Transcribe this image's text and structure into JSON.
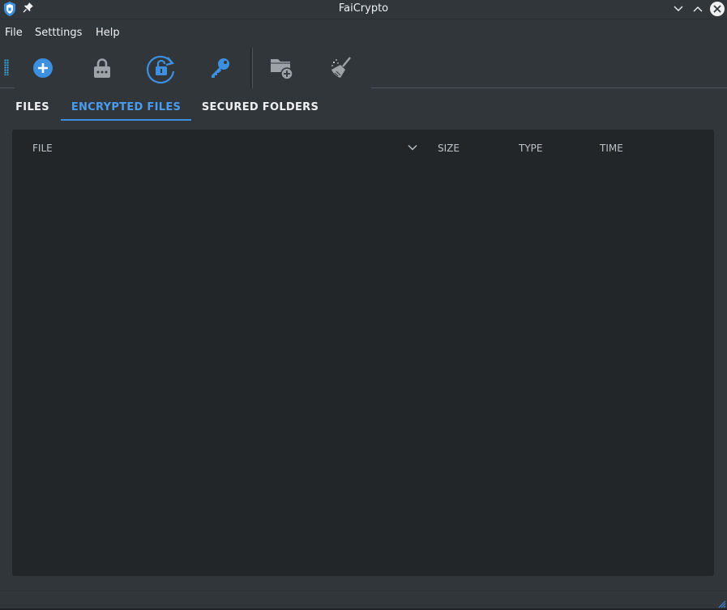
{
  "window": {
    "title": "FaiCrypto"
  },
  "menu": {
    "file": "File",
    "settings": "Setttings",
    "help": "Help"
  },
  "toolbar": {
    "buttons": [
      {
        "name": "add",
        "icon": "plus-circle-icon"
      },
      {
        "name": "encrypt",
        "icon": "lock-icon"
      },
      {
        "name": "decrypt",
        "icon": "unlock-refresh-icon"
      },
      {
        "name": "key",
        "icon": "key-icon"
      },
      {
        "name": "add-folder",
        "icon": "folder-plus-icon"
      },
      {
        "name": "clean",
        "icon": "broom-icon"
      }
    ]
  },
  "tabs": [
    {
      "label": "FILES",
      "active": false
    },
    {
      "label": "ENCRYPTED FILES",
      "active": true
    },
    {
      "label": "SECURED FOLDERS",
      "active": false
    }
  ],
  "table": {
    "columns": [
      "FILE",
      "SIZE",
      "TYPE",
      "TIME"
    ],
    "rows": []
  },
  "colors": {
    "accent": "#3d8fe0",
    "background": "#31363b",
    "panel": "#232629"
  }
}
